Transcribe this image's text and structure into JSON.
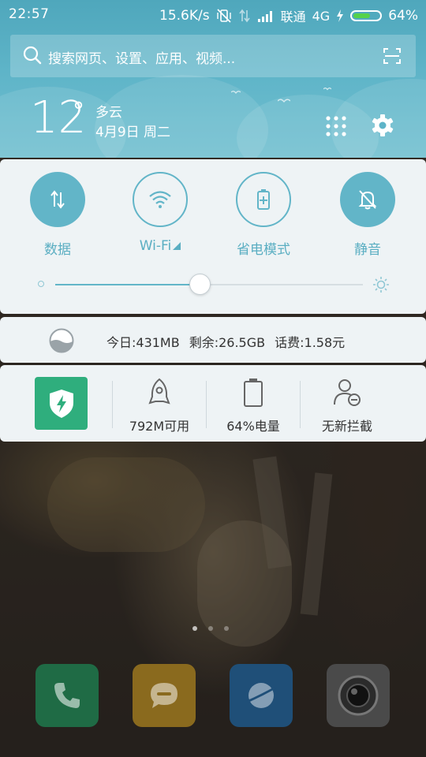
{
  "status_bar": {
    "time": "22:57",
    "net_speed": "15.6K/s",
    "carrier": "联通",
    "network": "4G",
    "battery_percent": "64%",
    "battery_level": 0.64,
    "icons": [
      "vibrate-off-icon",
      "data-transfer-icon",
      "signal-icon",
      "charging-icon",
      "battery-icon"
    ]
  },
  "search": {
    "placeholder": "搜索网页、设置、应用、视频..."
  },
  "weather": {
    "temperature": "12",
    "degree": "°",
    "condition": "多云",
    "date": "4月9日 周二"
  },
  "toggles": [
    {
      "label": "数据",
      "icon": "data-transfer-icon",
      "state": "on"
    },
    {
      "label": "Wi-Fi",
      "icon": "wifi-icon",
      "state": "off"
    },
    {
      "label": "省电模式",
      "icon": "battery-saver-icon",
      "state": "off"
    },
    {
      "label": "静音",
      "icon": "bell-muted-icon",
      "state": "on"
    }
  ],
  "brightness": {
    "level": 0.47
  },
  "usage": {
    "today": "今日:431MB",
    "remaining": "剩余:26.5GB",
    "balance": "话费:1.58元"
  },
  "shortcuts": [
    {
      "label": "792M可用",
      "icon": "rocket-icon"
    },
    {
      "label": "64%电量",
      "icon": "battery-icon"
    },
    {
      "label": "无新拦截",
      "icon": "user-block-icon"
    }
  ],
  "dock": [
    {
      "name": "phone",
      "icon": "phone-icon",
      "color": "#1f6b45"
    },
    {
      "name": "messages",
      "icon": "message-icon",
      "color": "#8a6a1e"
    },
    {
      "name": "browser",
      "icon": "globe-icon",
      "color": "#1f4f78"
    },
    {
      "name": "camera",
      "icon": "camera-icon",
      "color": "#4a4a4a"
    }
  ],
  "colors": {
    "accent": "#62b5c8",
    "header": "#5eb4c8",
    "battery_fill": "#55d24a",
    "security_green": "#2fae7d"
  }
}
